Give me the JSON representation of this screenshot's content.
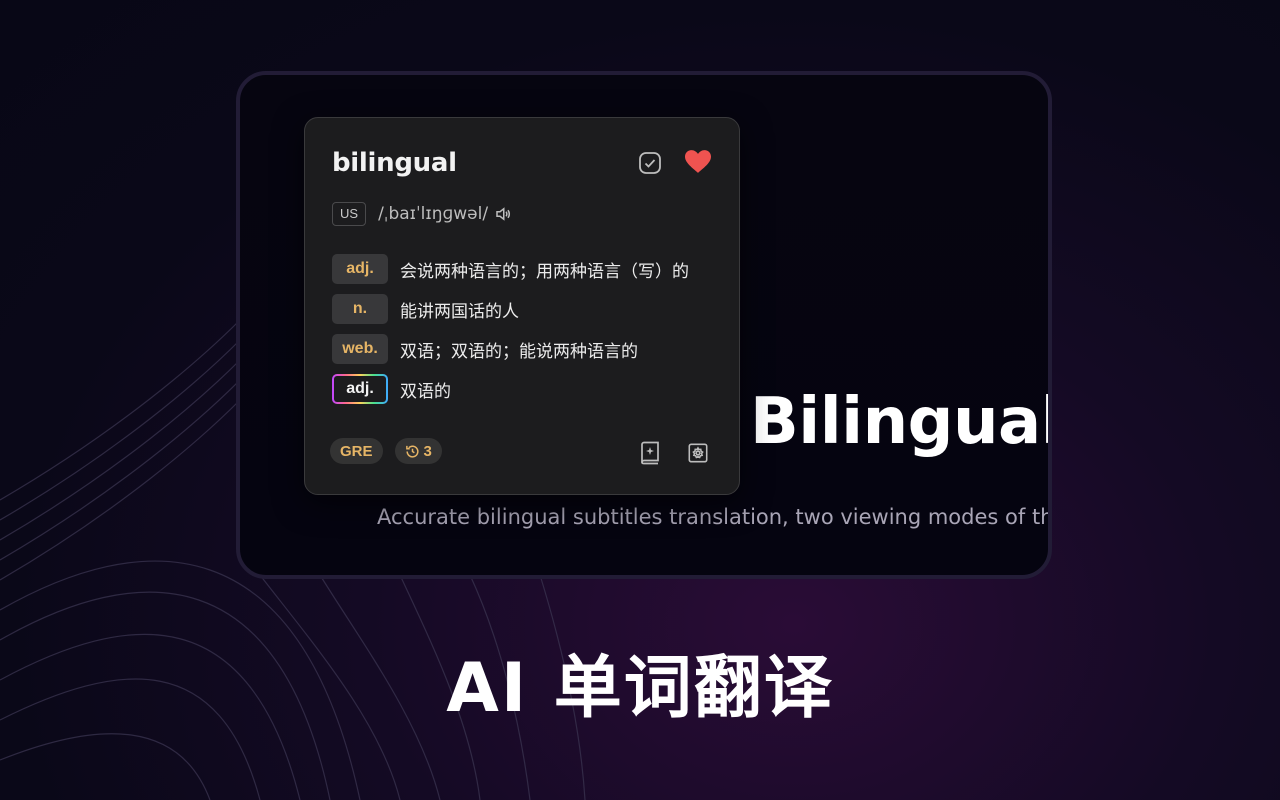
{
  "promo": {
    "headline": "AI 单词翻译"
  },
  "background_video": {
    "title": "Bilingual",
    "subtitle": "Accurate bilingual subtitles translation, two viewing modes of th"
  },
  "popup": {
    "word": "bilingual",
    "region": "US",
    "phonetic": "/ˌbaɪˈlɪŋɡwəl/",
    "definitions": [
      {
        "pos": "adj.",
        "meaning": "会说两种语言的；用两种语言（写）的"
      },
      {
        "pos": "n.",
        "meaning": "能讲两国话的人"
      },
      {
        "pos": "web.",
        "meaning": "双语；双语的；能说两种语言的"
      },
      {
        "pos": "adj.",
        "meaning": "双语的"
      }
    ],
    "tags": {
      "exam": "GRE",
      "history_count": "3"
    },
    "icons": {
      "mark": "check-square-icon",
      "favorite": "heart-icon",
      "speaker": "speaker-icon",
      "history": "history-icon",
      "ai_book": "ai-book-icon",
      "settings": "settings-icon"
    },
    "colors": {
      "heart": "#ef5350",
      "pos_text": "#e6b566"
    }
  }
}
